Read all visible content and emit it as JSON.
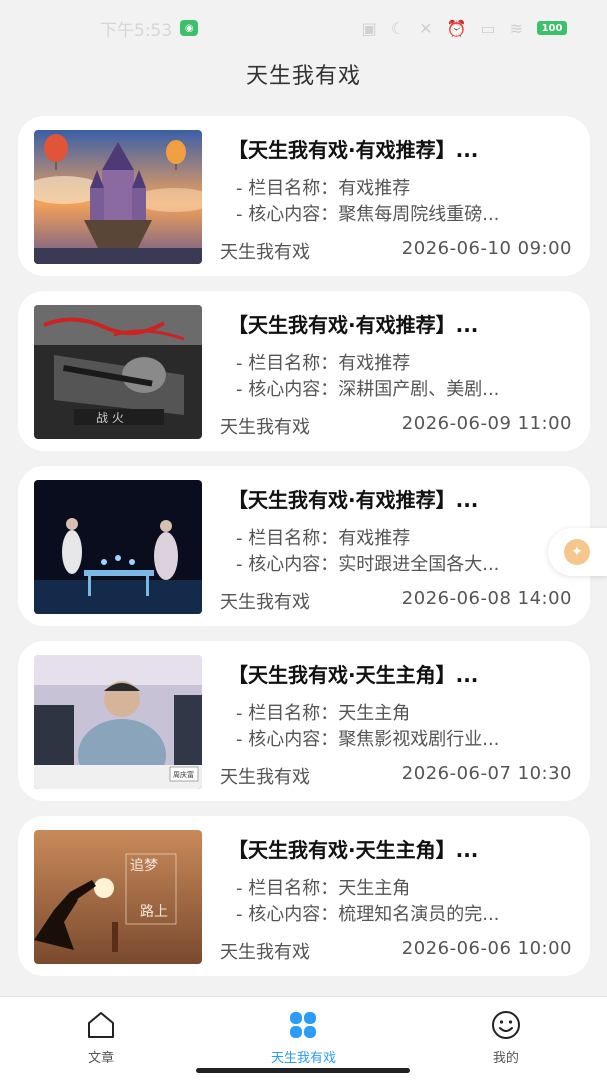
{
  "status": {
    "time": "下午5:53",
    "battery": "100"
  },
  "header": {
    "title": "天生我有戏"
  },
  "articles": [
    {
      "title": "【天生我有戏·有戏推荐】...",
      "column_label": "- 栏目名称：",
      "column": "有戏推荐",
      "content_label": "- 核心内容：",
      "content": "聚焦每周院线重磅...",
      "source": "天生我有戏",
      "date": "2026-06-10 09:00"
    },
    {
      "title": "【天生我有戏·有戏推荐】...",
      "column_label": "- 栏目名称：",
      "column": "有戏推荐",
      "content_label": "- 核心内容：",
      "content": "深耕国产剧、美剧...",
      "source": "天生我有戏",
      "date": "2026-06-09 11:00"
    },
    {
      "title": "【天生我有戏·有戏推荐】...",
      "column_label": "- 栏目名称：",
      "column": "有戏推荐",
      "content_label": "- 核心内容：",
      "content": "实时跟进全国各大...",
      "source": "天生我有戏",
      "date": "2026-06-08 14:00"
    },
    {
      "title": "【天生我有戏·天生主角】...",
      "column_label": "- 栏目名称：",
      "column": "天生主角",
      "content_label": "- 核心内容：",
      "content": "聚焦影视戏剧行业...",
      "source": "天生我有戏",
      "date": "2026-06-07 10:30"
    },
    {
      "title": "【天生我有戏·天生主角】...",
      "column_label": "- 栏目名称：",
      "column": "天生主角",
      "content_label": "- 核心内容：",
      "content": "梳理知名演员的完...",
      "source": "天生我有戏",
      "date": "2026-06-06 10:00"
    }
  ],
  "tabs": [
    {
      "label": "文章",
      "icon": "home-icon"
    },
    {
      "label": "天生我有戏",
      "icon": "clover-icon",
      "active": true
    },
    {
      "label": "我的",
      "icon": "smiley-icon"
    }
  ],
  "colors": {
    "accent": "#2a9df4",
    "float_button": "#f5c78e"
  }
}
